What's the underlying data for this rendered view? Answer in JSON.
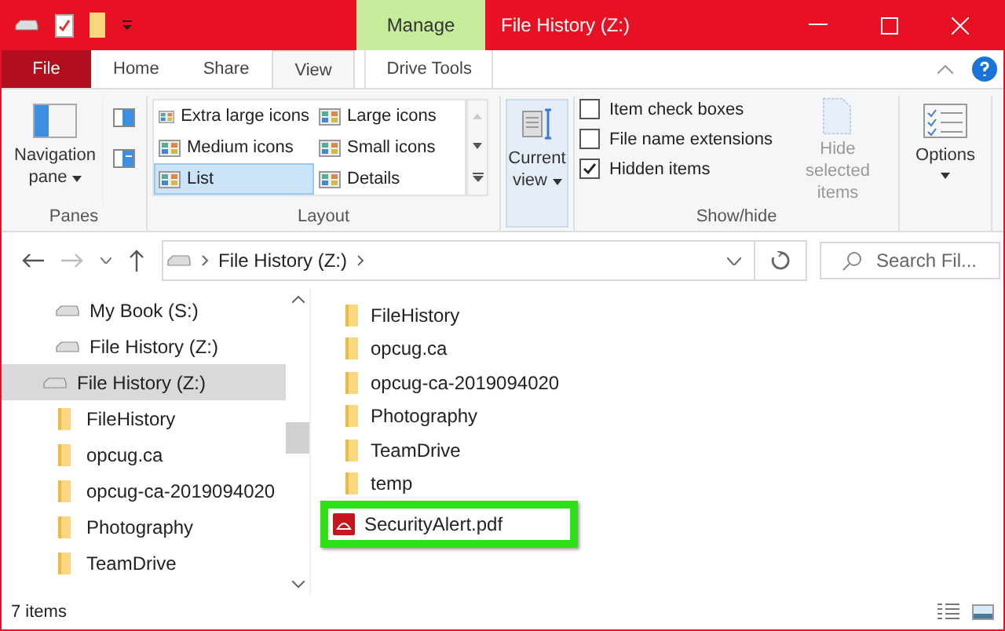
{
  "window": {
    "title": "File History (Z:)",
    "context_tab": "Manage"
  },
  "ribbon_tabs": [
    {
      "label": "File",
      "kind": "file",
      "selected": false
    },
    {
      "label": "Home",
      "kind": "tab",
      "selected": false
    },
    {
      "label": "Share",
      "kind": "tab",
      "selected": false
    },
    {
      "label": "View",
      "kind": "tab",
      "selected": true
    },
    {
      "label": "Drive Tools",
      "kind": "context",
      "selected": false
    }
  ],
  "ribbon": {
    "panes": {
      "button": "Navigation pane",
      "label": "Panes"
    },
    "layout": {
      "label": "Layout",
      "options": [
        {
          "label": "Extra large icons",
          "selected": false
        },
        {
          "label": "Large icons",
          "selected": false
        },
        {
          "label": "Medium icons",
          "selected": false
        },
        {
          "label": "Small icons",
          "selected": false
        },
        {
          "label": "List",
          "selected": true
        },
        {
          "label": "Details",
          "selected": false
        }
      ]
    },
    "current_view": "Current view",
    "show_hide": {
      "label": "Show/hide",
      "checkboxes": [
        {
          "label": "Item check boxes",
          "checked": false
        },
        {
          "label": "File name extensions",
          "checked": false
        },
        {
          "label": "Hidden items",
          "checked": true
        }
      ],
      "hide_selected": {
        "label": "Hide selected items",
        "disabled": true
      }
    },
    "options": "Options"
  },
  "address": {
    "path": "File History (Z:)",
    "search_placeholder": "Search Fil..."
  },
  "nav_pane": [
    {
      "label": "My Book (S:)",
      "kind": "drive",
      "selected": false
    },
    {
      "label": "File History (Z:)",
      "kind": "drive",
      "selected": false
    },
    {
      "label": "File History (Z:)",
      "kind": "drive",
      "selected": true,
      "children": [
        {
          "label": "FileHistory",
          "kind": "folder",
          "selected": false
        },
        {
          "label": "opcug.ca",
          "kind": "folder",
          "selected": false
        },
        {
          "label": "opcug-ca-2019094020",
          "kind": "folder",
          "selected": false
        },
        {
          "label": "Photography",
          "kind": "folder",
          "selected": false
        },
        {
          "label": "TeamDrive",
          "kind": "folder",
          "selected": false
        }
      ]
    }
  ],
  "files": [
    {
      "name": "FileHistory",
      "kind": "folder",
      "highlighted": false
    },
    {
      "name": "opcug.ca",
      "kind": "folder",
      "highlighted": false
    },
    {
      "name": "opcug-ca-2019094020",
      "kind": "folder",
      "highlighted": false
    },
    {
      "name": "Photography",
      "kind": "folder",
      "highlighted": false
    },
    {
      "name": "TeamDrive",
      "kind": "folder",
      "highlighted": false
    },
    {
      "name": "temp",
      "kind": "folder",
      "highlighted": false
    },
    {
      "name": "SecurityAlert.pdf",
      "kind": "pdf",
      "highlighted": true
    }
  ],
  "status_bar": {
    "count": "7 items"
  }
}
